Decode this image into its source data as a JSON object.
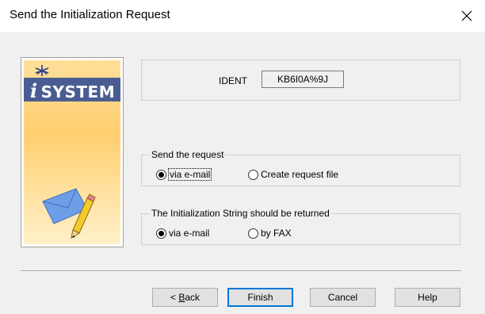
{
  "window": {
    "title": "Send the Initialization Request",
    "close_icon": "close-icon"
  },
  "image_panel": {
    "logo_text": "SYSTEM",
    "logo_prefix": "i",
    "icons": [
      "star-icon",
      "envelope-icon",
      "pencil-icon"
    ]
  },
  "ident": {
    "label": "IDENT",
    "value": "KB6I0A%9J"
  },
  "send_request": {
    "legend": "Send the request",
    "options": [
      {
        "label": "via e-mail",
        "selected": true
      },
      {
        "label": "Create request file",
        "selected": false
      }
    ]
  },
  "return_method": {
    "legend": "The Initialization String should be returned",
    "options": [
      {
        "label": "via e-mail",
        "selected": true
      },
      {
        "label": "by FAX",
        "selected": false
      }
    ]
  },
  "buttons": {
    "back_prefix": "< ",
    "back_accel": "B",
    "back_rest": "ack",
    "finish": "Finish",
    "cancel": "Cancel",
    "help": "Help"
  }
}
